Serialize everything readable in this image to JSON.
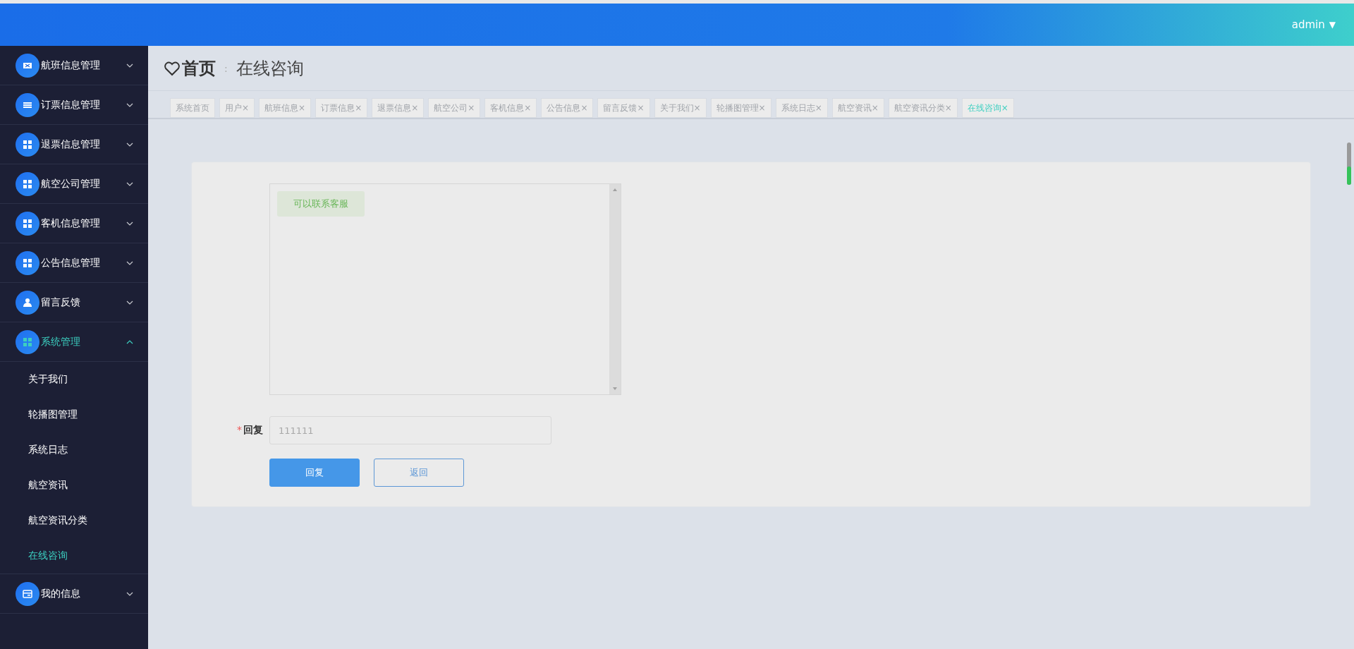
{
  "top_bar": {
    "user": "admin",
    "caret": "▼"
  },
  "sidebar": {
    "items": [
      {
        "label": "航班信息管理",
        "expanded": false,
        "selected": false
      },
      {
        "label": "订票信息管理",
        "expanded": false,
        "selected": false
      },
      {
        "label": "退票信息管理",
        "expanded": false,
        "selected": false
      },
      {
        "label": "航空公司管理",
        "expanded": false,
        "selected": false
      },
      {
        "label": "客机信息管理",
        "expanded": false,
        "selected": false
      },
      {
        "label": "公告信息管理",
        "expanded": false,
        "selected": false
      },
      {
        "label": "留言反馈",
        "expanded": false,
        "selected": false
      },
      {
        "label": "系统管理",
        "expanded": true,
        "selected": true,
        "children": [
          {
            "label": "关于我们",
            "selected": false
          },
          {
            "label": "轮播图管理",
            "selected": false
          },
          {
            "label": "系统日志",
            "selected": false
          },
          {
            "label": "航空资讯",
            "selected": false
          },
          {
            "label": "航空资讯分类",
            "selected": false
          },
          {
            "label": "在线咨询",
            "selected": true
          }
        ]
      },
      {
        "label": "我的信息",
        "expanded": false,
        "selected": false
      }
    ]
  },
  "breadcrumb": {
    "home": "首页",
    "separator": ":",
    "current": "在线咨询"
  },
  "tabs": [
    {
      "label": "系统首页",
      "selected": false
    },
    {
      "label": "用户",
      "close": "×",
      "selected": false
    },
    {
      "label": "航班信息",
      "close": "×",
      "selected": false
    },
    {
      "label": "订票信息",
      "close": "×",
      "selected": false
    },
    {
      "label": "退票信息",
      "close": "×",
      "selected": false
    },
    {
      "label": "航空公司",
      "close": "×",
      "selected": false
    },
    {
      "label": "客机信息",
      "close": "×",
      "selected": false
    },
    {
      "label": "公告信息",
      "close": "×",
      "selected": false
    },
    {
      "label": "留言反馈",
      "close": "×",
      "selected": false
    },
    {
      "label": "关于我们",
      "close": "×",
      "selected": false
    },
    {
      "label": "轮播图管理",
      "close": "×",
      "selected": false
    },
    {
      "label": "系统日志",
      "close": "×",
      "selected": false
    },
    {
      "label": "航空资讯",
      "close": "×",
      "selected": false
    },
    {
      "label": "航空资讯分类",
      "close": "×",
      "selected": false
    },
    {
      "label": "在线咨询",
      "close": "×",
      "selected": true
    }
  ],
  "chat": {
    "messages": [
      "可以联系客服"
    ]
  },
  "form": {
    "required_mark": "*",
    "label": "回复",
    "value": "111111"
  },
  "buttons": [
    {
      "label": "回复",
      "kind": "primary"
    },
    {
      "label": "返回",
      "kind": "plain"
    }
  ]
}
